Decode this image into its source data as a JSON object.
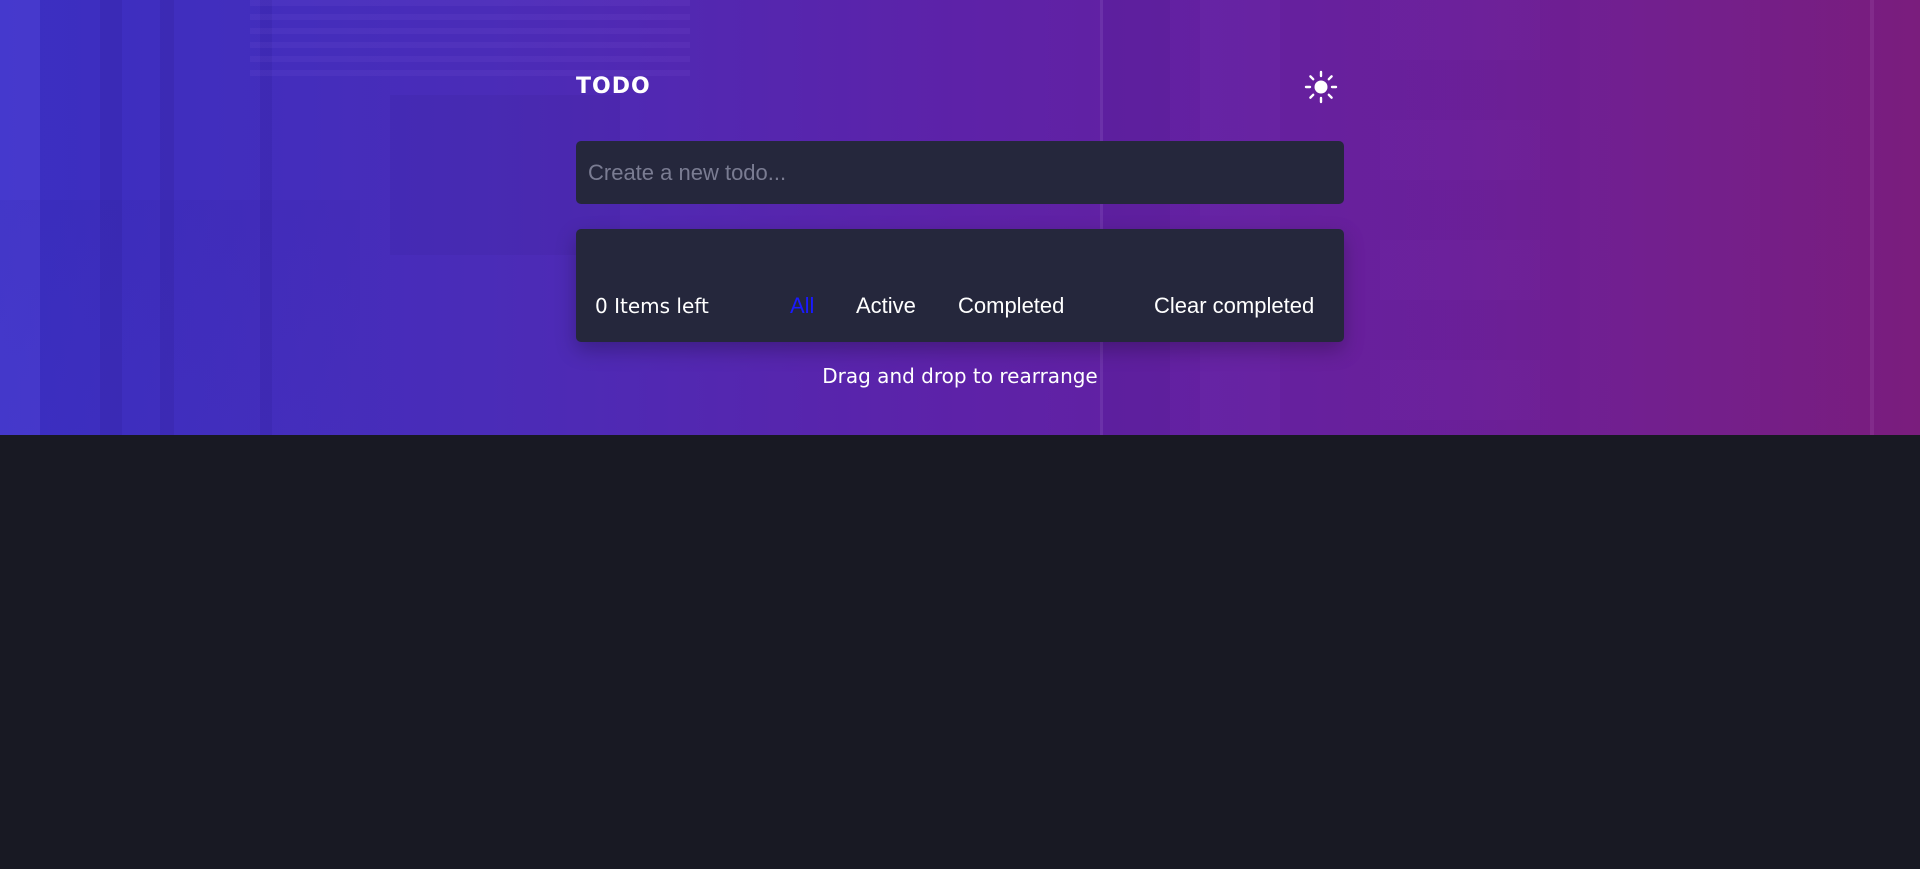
{
  "app": {
    "title": "TODO"
  },
  "theme_toggle": {
    "icon": "sun-icon"
  },
  "new_todo": {
    "placeholder": "Create a new todo...",
    "value": ""
  },
  "footer": {
    "items_left": "0 Items left",
    "filters": [
      {
        "label": "All",
        "active": true
      },
      {
        "label": "Active",
        "active": false
      },
      {
        "label": "Completed",
        "active": false
      }
    ],
    "clear_completed": "Clear completed"
  },
  "hint": "Drag and drop to rearrange",
  "colors": {
    "page_bg": "#181923",
    "panel_bg": "#25273c",
    "active_filter": "#1a1aff",
    "text": "#ffffff"
  }
}
